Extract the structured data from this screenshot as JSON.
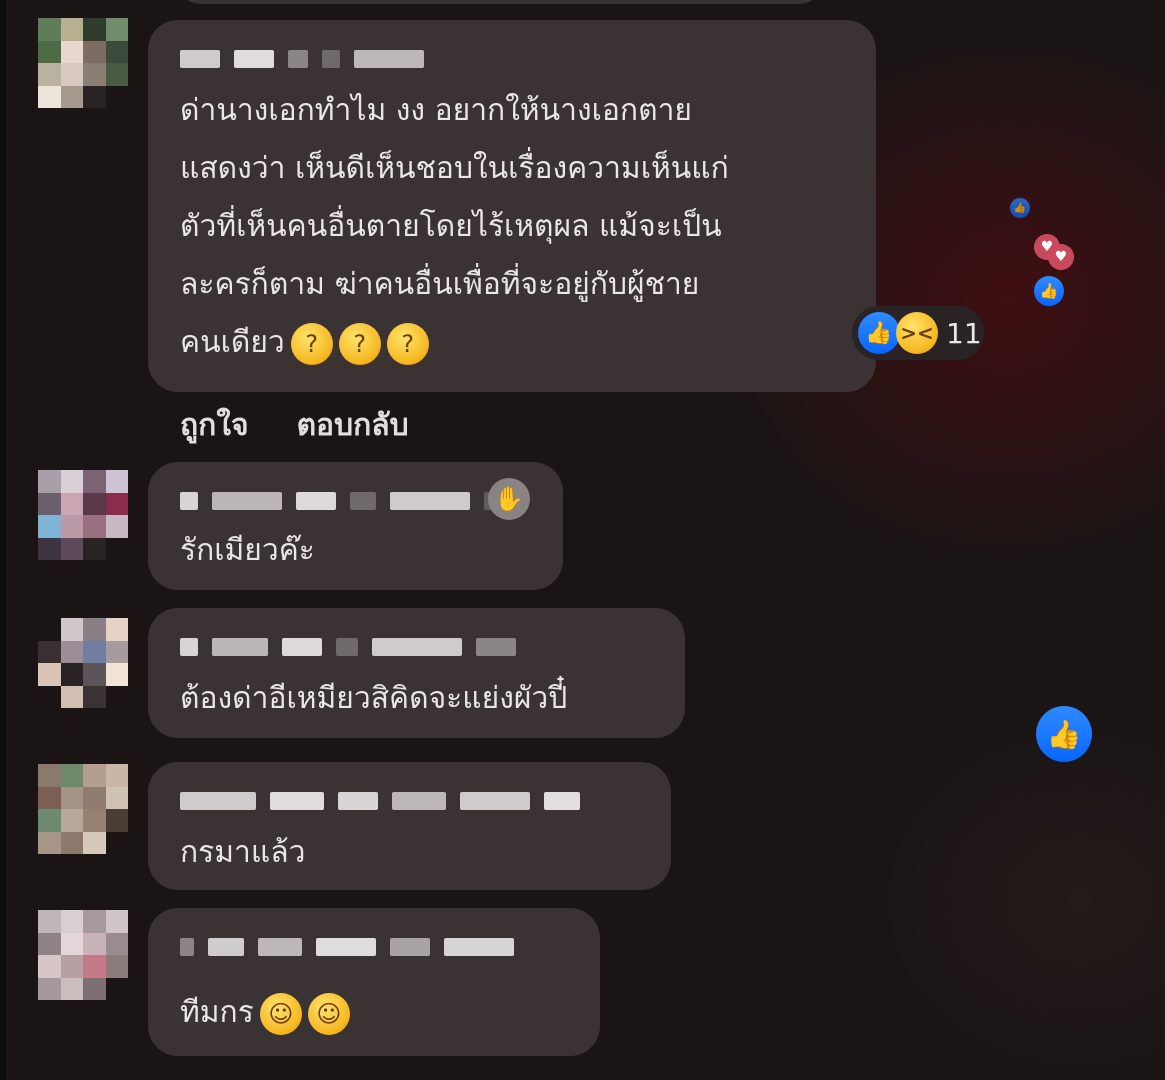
{
  "comments": [
    {
      "text": "ด่านางเอกทำไม งง  อยากให้นางเอกตาย\nแสดงว่า เห็นดีเห็นชอบในเรื่องความเห็นแก่\nตัวที่เห็นคนอื่นตายโดยไร้เหตุผล  แม้จะเป็น\nละครก็ตาม   ฆ่าคนอื่นเพื่อที่จะอยู่กับผู้ชาย\nคนเดียว",
      "emoji": [
        "thinking-face",
        "thinking-face",
        "thinking-face"
      ],
      "reaction_count": "11",
      "reaction_icons": [
        "like-icon",
        "haha-icon"
      ]
    },
    {
      "text": "รักเมียวค๊ะ",
      "badge_icon": "waving-hand-icon"
    },
    {
      "text": "ต้องด่าอีเหมียวสิคิดจะแย่งผัวปี๋"
    },
    {
      "text": "กรมาแล้ว"
    },
    {
      "text": "ทีมกร",
      "emoji": [
        "grinning-face",
        "grinning-face"
      ]
    }
  ],
  "actions": {
    "like_label": "ถูกใจ",
    "reply_label": "ตอบกลับ"
  },
  "colors": {
    "bubble": "#3a3233",
    "like_blue": "#0866ff",
    "text": "#e9e6e6"
  }
}
